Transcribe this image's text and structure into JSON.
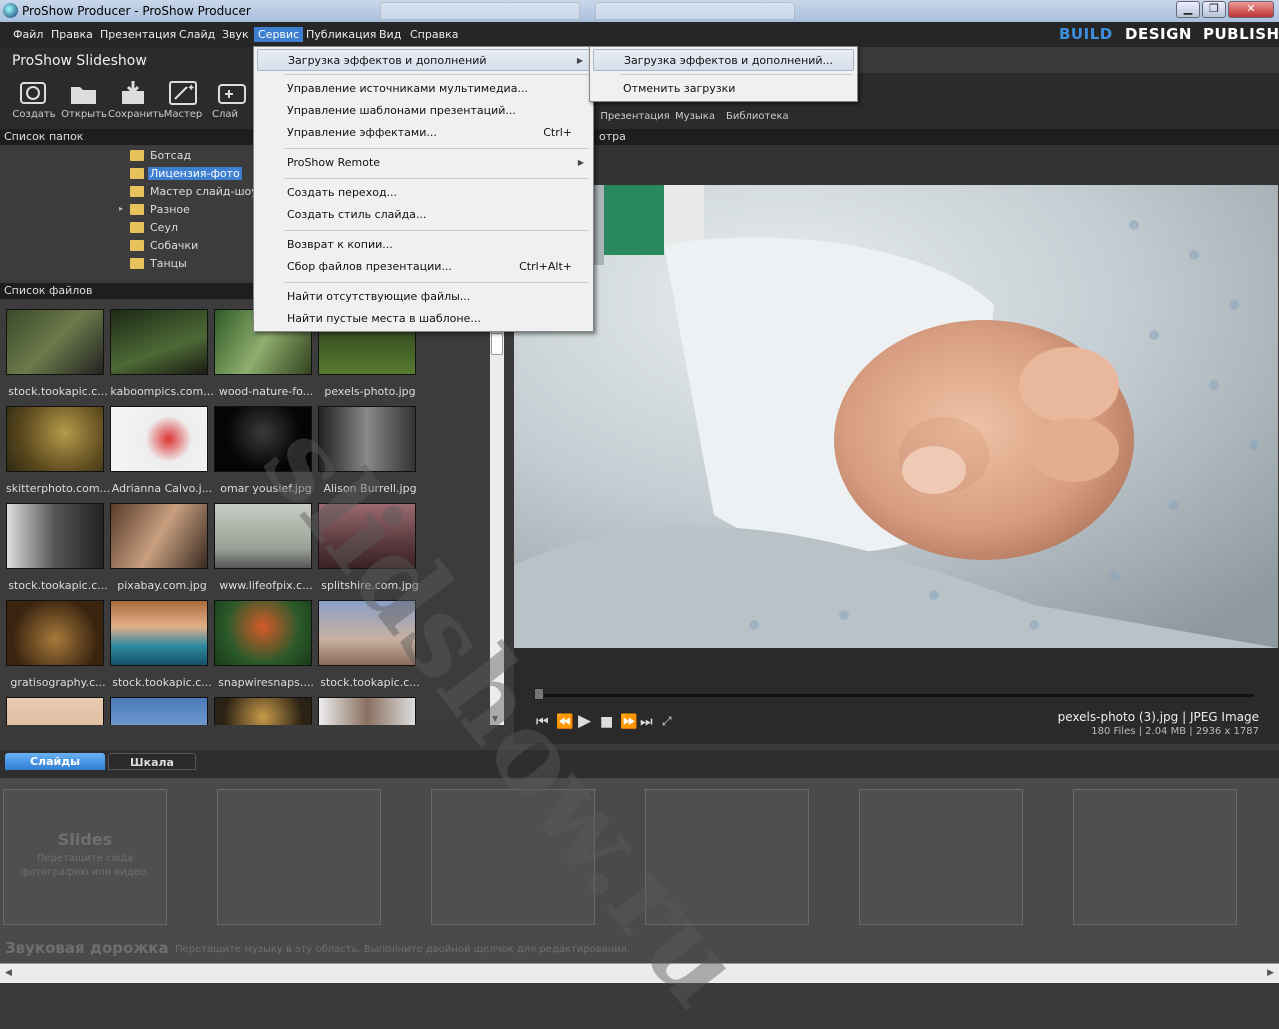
{
  "window": {
    "title": "ProShow Producer - ProShow Producer",
    "min_label": "▁",
    "max_label": "❐",
    "close_label": "✕"
  },
  "menubar": {
    "items": [
      "Файл",
      "Правка",
      "Презентация",
      "Слайд",
      "Звук",
      "Сервис",
      "Публикация",
      "Вид",
      "Справка"
    ],
    "modes": [
      "BUILD",
      "DESIGN",
      "PUBLISH"
    ],
    "active_mode_color": "#3d8fe0"
  },
  "project": {
    "title": "ProShow Slideshow"
  },
  "toolbar": {
    "left": [
      "Создать",
      "Открыть",
      "Сохранить",
      "Мастер",
      "Слай"
    ],
    "right": [
      "Презентация",
      "Музыка",
      "Библиотека"
    ]
  },
  "panels": {
    "folders_title": "Список папок",
    "files_title": "Список файлов",
    "preview_title": "отра"
  },
  "folders": [
    {
      "label": "Ботсад",
      "selected": false,
      "arrow": ""
    },
    {
      "label": "Лицензия-фото",
      "selected": true,
      "arrow": ""
    },
    {
      "label": "Мастер слайд-шоу",
      "selected": false,
      "arrow": ""
    },
    {
      "label": "Разное",
      "selected": false,
      "arrow": "▸"
    },
    {
      "label": "Сеул",
      "selected": false,
      "arrow": ""
    },
    {
      "label": "Собачки",
      "selected": false,
      "arrow": ""
    },
    {
      "label": "Танцы",
      "selected": false,
      "arrow": ""
    }
  ],
  "files": [
    [
      "stock.tookapic.c...",
      "kaboompics.com...",
      "wood-nature-fo...",
      "pexels-photo.jpg"
    ],
    [
      "skitterphoto.com...",
      "Adrianna Calvo.j...",
      "omar yousief.jpg",
      "Alison Burrell.jpg"
    ],
    [
      "stock.tookapic.c...",
      "pixabay.com.jpg",
      "www.lifeofpix.c...",
      "splitshire.com.jpg"
    ],
    [
      "gratisography.c...",
      "stock.tookapic.c...",
      "snapwiresnaps....",
      "stock.tookapic.c..."
    ]
  ],
  "preview": {
    "filename_line": "pexels-photo (3).jpg  |  JPEG Image",
    "stats_line": "180 Files  |  2.04 MB  |  2936 x 1787",
    "progress": 0.0
  },
  "tabs": [
    "Слайды",
    "Шкала"
  ],
  "slides": {
    "placeholder_title": "Slides",
    "placeholder_hint": "Перетащите сюда фотографию или видео."
  },
  "audio": {
    "title": "Звуковая дорожка",
    "hint": "Перетащите музыку в эту область. Выполните двойной щелчок для редактирования."
  },
  "service_menu": [
    {
      "label": "Загрузка эффектов и дополнений",
      "shortcut": "",
      "submenu": true,
      "highlighted": true
    },
    {
      "sep": true
    },
    {
      "label": "Управление источниками мультимедиа...",
      "shortcut": ""
    },
    {
      "label": "Управление шаблонами презентаций...",
      "shortcut": ""
    },
    {
      "label": "Управление эффектами...",
      "shortcut": "Ctrl+"
    },
    {
      "sep": true
    },
    {
      "label": "ProShow Remote",
      "shortcut": "",
      "submenu": true
    },
    {
      "sep": true
    },
    {
      "label": "Создать переход...",
      "shortcut": ""
    },
    {
      "label": "Создать стиль слайда...",
      "shortcut": ""
    },
    {
      "sep": true
    },
    {
      "label": "Возврат к копии...",
      "shortcut": ""
    },
    {
      "label": "Сбор файлов презентации...",
      "shortcut": "Ctrl+Alt+"
    },
    {
      "sep": true
    },
    {
      "label": "Найти отсутствующие файлы...",
      "shortcut": ""
    },
    {
      "label": "Найти пустые места в шаблоне...",
      "shortcut": ""
    }
  ],
  "sub_menu": [
    {
      "label": "Загрузка эффектов и дополнений...",
      "highlighted": true
    },
    {
      "sep": true
    },
    {
      "label": "Отменить загрузки",
      "highlighted": false
    }
  ],
  "watermark": "slidshow.ru"
}
